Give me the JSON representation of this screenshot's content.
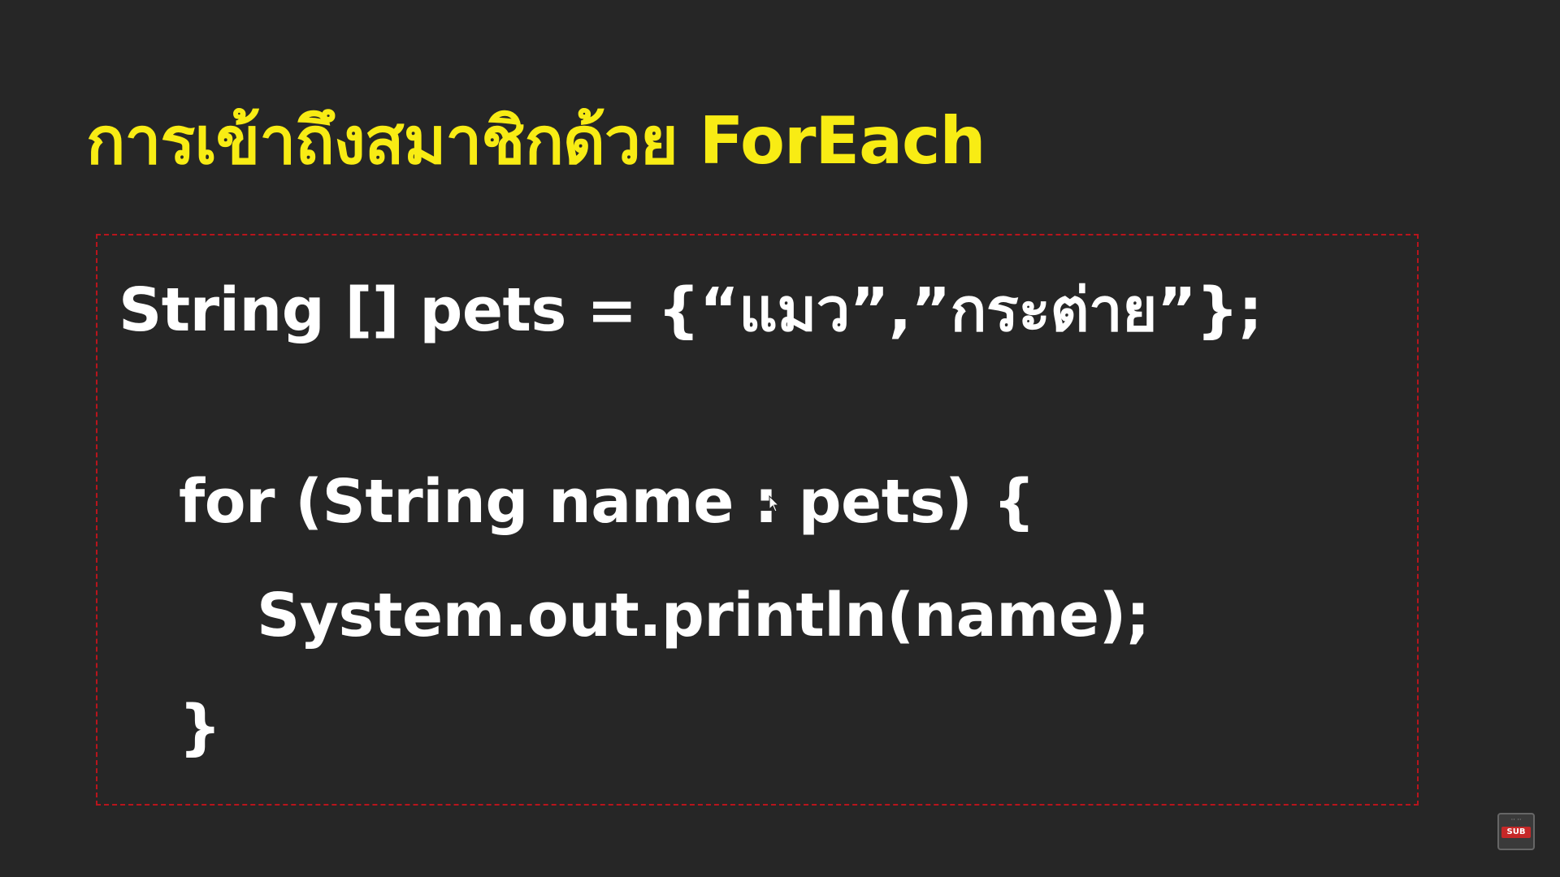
{
  "slide": {
    "title": "การเข้าถึงสมาชิกด้วย ForEach",
    "colors": {
      "background": "#262626",
      "title": "#f8ec14",
      "code_text": "#ffffff",
      "box_border": "#b8141c"
    }
  },
  "code": {
    "lines": [
      "String [] pets = {“แมว”,”กระต่าย”};",
      "for (String name : pets) {",
      "System.out.println(name);",
      "}"
    ]
  },
  "overlay": {
    "cursor_icon": "mouse-pointer-icon",
    "badge_label": "SUB",
    "badge_icon": "subtitles-icon"
  }
}
